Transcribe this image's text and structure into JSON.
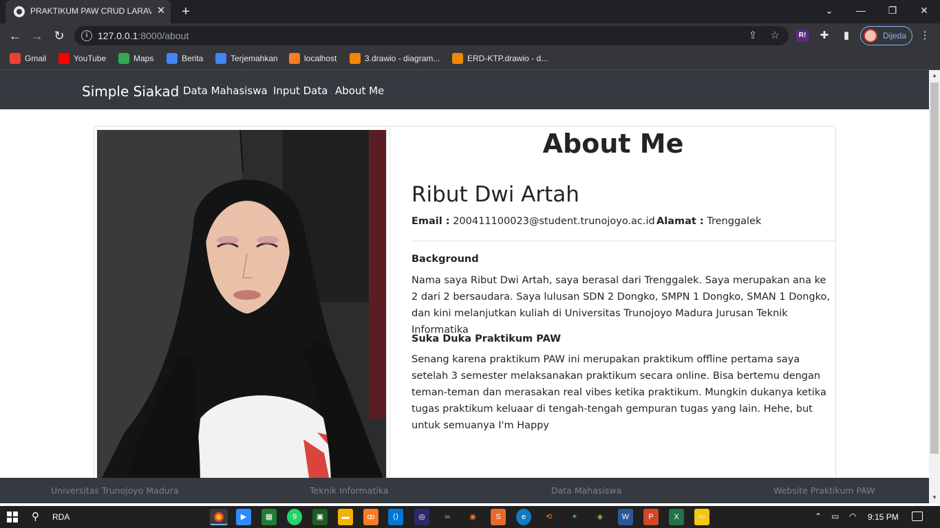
{
  "browser": {
    "tab_title": "PRAKTIKUM PAW CRUD LARAVEL",
    "tab_close": "✕",
    "new_tab": "+",
    "url_host": "127.0.0.1",
    "url_path": ":8000/about",
    "profile_name": "Dijeda",
    "bookmarks": [
      {
        "label": "Gmail",
        "icon": "gmail-icon",
        "color": "#ea4335"
      },
      {
        "label": "YouTube",
        "icon": "youtube-icon",
        "color": "#ff0000"
      },
      {
        "label": "Maps",
        "icon": "maps-icon",
        "color": "#34a853"
      },
      {
        "label": "Berita",
        "icon": "news-icon",
        "color": "#4285f4"
      },
      {
        "label": "Terjemahkan",
        "icon": "translate-icon",
        "color": "#4285f4"
      },
      {
        "label": "localhost",
        "icon": "xampp-icon",
        "color": "#fb7a24"
      },
      {
        "label": "3.drawio - diagram...",
        "icon": "drawio-icon",
        "color": "#f08705"
      },
      {
        "label": "ERD-KTP.drawio - d...",
        "icon": "drawio-icon",
        "color": "#f08705"
      }
    ]
  },
  "navbar": {
    "brand": "Simple Siakad",
    "links": [
      "Data Mahasiswa",
      "Input Data",
      "About Me"
    ]
  },
  "about": {
    "heading": "About Me",
    "name": "Ribut Dwi Artah",
    "email_label": "Email :",
    "email": "200411100023@student.trunojoyo.ac.id",
    "address_label": "Alamat :",
    "address": "Trenggalek",
    "background_title": "Background",
    "background_text": "Nama saya Ribut Dwi Artah, saya berasal dari Trenggalek. Saya merupakan ana ke 2 dari 2 bersaudara. Saya lulusan SDN 2 Dongko, SMPN 1 Dongko, SMAN 1 Dongko, dan kini melanjutkan kuliah di Universitas Trunojoyo Madura Jurusan Teknik Informatika",
    "experience_title": "Suka Duka Praktikum PAW",
    "experience_text": "Senang karena praktikum PAW ini merupakan praktikum offline pertama saya setelah 3 semester melaksanakan praktikum secara online. Bisa bertemu dengan teman-teman dan merasakan real vibes ketika praktikum. Mungkin dukanya ketika tugas praktikum keluaar di tengah-tengah gempuran tugas yang lain. Hehe, but untuk semuanya I'm Happy"
  },
  "footer": {
    "links": [
      "Universitas Trunojoyo Madura",
      "Teknik Informatika",
      "Data Mahasiswa",
      "Website Praktikum PAW"
    ]
  },
  "taskbar": {
    "search_text": "RDA",
    "clock": "9:15 PM"
  }
}
